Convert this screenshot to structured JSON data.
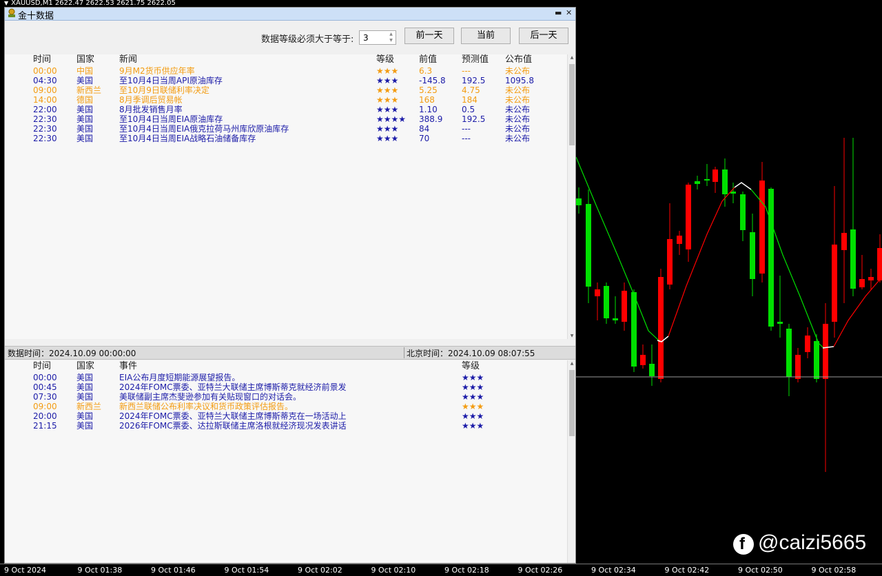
{
  "top_bar": {
    "text": "XAUUSD,M1  2622.47 2622.53 2621.75 2622.05"
  },
  "panel": {
    "title": "金十数据",
    "minimize_glyph": "▬",
    "close_glyph": "✕"
  },
  "toolbar": {
    "level_label": "数据等级必须大于等于:",
    "level_value": "3",
    "prev_day": "前一天",
    "current": "当前",
    "next_day": "后一天"
  },
  "data_table": {
    "headers": [
      "时间",
      "国家",
      "新闻",
      "等级",
      "前值",
      "预测值",
      "公布值"
    ],
    "rows": [
      {
        "time": "00:00",
        "country": "中国",
        "news": "9月M2货币供应年率",
        "stars": "★★★",
        "prev": "6.3",
        "forecast": "---",
        "actual": "未公布",
        "color": "orange"
      },
      {
        "time": "04:30",
        "country": "美国",
        "news": "至10月4日当周API原油库存",
        "stars": "★★★",
        "prev": "-145.8",
        "forecast": "192.5",
        "actual": "1095.8",
        "color": "blue"
      },
      {
        "time": "09:00",
        "country": "新西兰",
        "news": "至10月9日联储利率决定",
        "stars": "★★★",
        "prev": "5.25",
        "forecast": "4.75",
        "actual": "未公布",
        "color": "orange"
      },
      {
        "time": "14:00",
        "country": "德国",
        "news": "8月季调后贸易帐",
        "stars": "★★★",
        "prev": "168",
        "forecast": "184",
        "actual": "未公布",
        "color": "orange"
      },
      {
        "time": "22:00",
        "country": "美国",
        "news": "8月批发销售月率",
        "stars": "★★★",
        "prev": "1.10",
        "forecast": "0.5",
        "actual": "未公布",
        "color": "blue"
      },
      {
        "time": "22:30",
        "country": "美国",
        "news": "至10月4日当周EIA原油库存",
        "stars": "★★★★",
        "prev": "388.9",
        "forecast": "192.5",
        "actual": "未公布",
        "color": "blue"
      },
      {
        "time": "22:30",
        "country": "美国",
        "news": "至10月4日当周EIA俄克拉荷马州库欣原油库存",
        "stars": "★★★",
        "prev": "84",
        "forecast": "---",
        "actual": "未公布",
        "color": "blue"
      },
      {
        "time": "22:30",
        "country": "美国",
        "news": "至10月4日当周EIA战略石油储备库存",
        "stars": "★★★",
        "prev": "70",
        "forecast": "---",
        "actual": "未公布",
        "color": "blue"
      }
    ]
  },
  "status": {
    "data_time": "数据时间：2024.10.09 00:00:00",
    "beijing_time": "北京时间：2024.10.09 08:07:55"
  },
  "events_table": {
    "headers": [
      "时间",
      "国家",
      "事件",
      "等级"
    ],
    "rows": [
      {
        "time": "00:00",
        "country": "美国",
        "event": "EIA公布月度短期能源展望报告。",
        "stars": "★★★",
        "color": "blue"
      },
      {
        "time": "00:45",
        "country": "美国",
        "event": "2024年FOMC票委、亚特兰大联储主席博斯蒂克就经济前景发",
        "stars": "★★★",
        "color": "blue"
      },
      {
        "time": "07:30",
        "country": "美国",
        "event": "美联储副主席杰斐逊参加有关贴现窗口的对话会。",
        "stars": "★★★",
        "color": "blue"
      },
      {
        "time": "09:00",
        "country": "新西兰",
        "event": "新西兰联储公布利率决议和货币政策评估报告。",
        "stars": "★★★",
        "color": "orange"
      },
      {
        "time": "20:00",
        "country": "美国",
        "event": "2024年FOMC票委、亚特兰大联储主席博斯蒂克在一场活动上",
        "stars": "★★★",
        "color": "blue"
      },
      {
        "time": "21:15",
        "country": "美国",
        "event": "2026年FOMC票委、达拉斯联储主席洛根就经济现况发表讲话",
        "stars": "★★★",
        "color": "blue"
      }
    ]
  },
  "time_axis": [
    "9 Oct 2024",
    "9 Oct 01:38",
    "9 Oct 01:46",
    "9 Oct 01:54",
    "9 Oct 02:02",
    "9 Oct 02:10",
    "9 Oct 02:18",
    "9 Oct 02:26",
    "9 Oct 02:34",
    "9 Oct 02:42",
    "9 Oct 02:50",
    "9 Oct 02:58"
  ],
  "watermark": {
    "text": "@caizi5665",
    "icon": "facebook-icon"
  },
  "colors": {
    "orange": "#f39c12",
    "blue": "#1c1ca8",
    "bull": "#00e000",
    "bear": "#ff0000"
  }
}
